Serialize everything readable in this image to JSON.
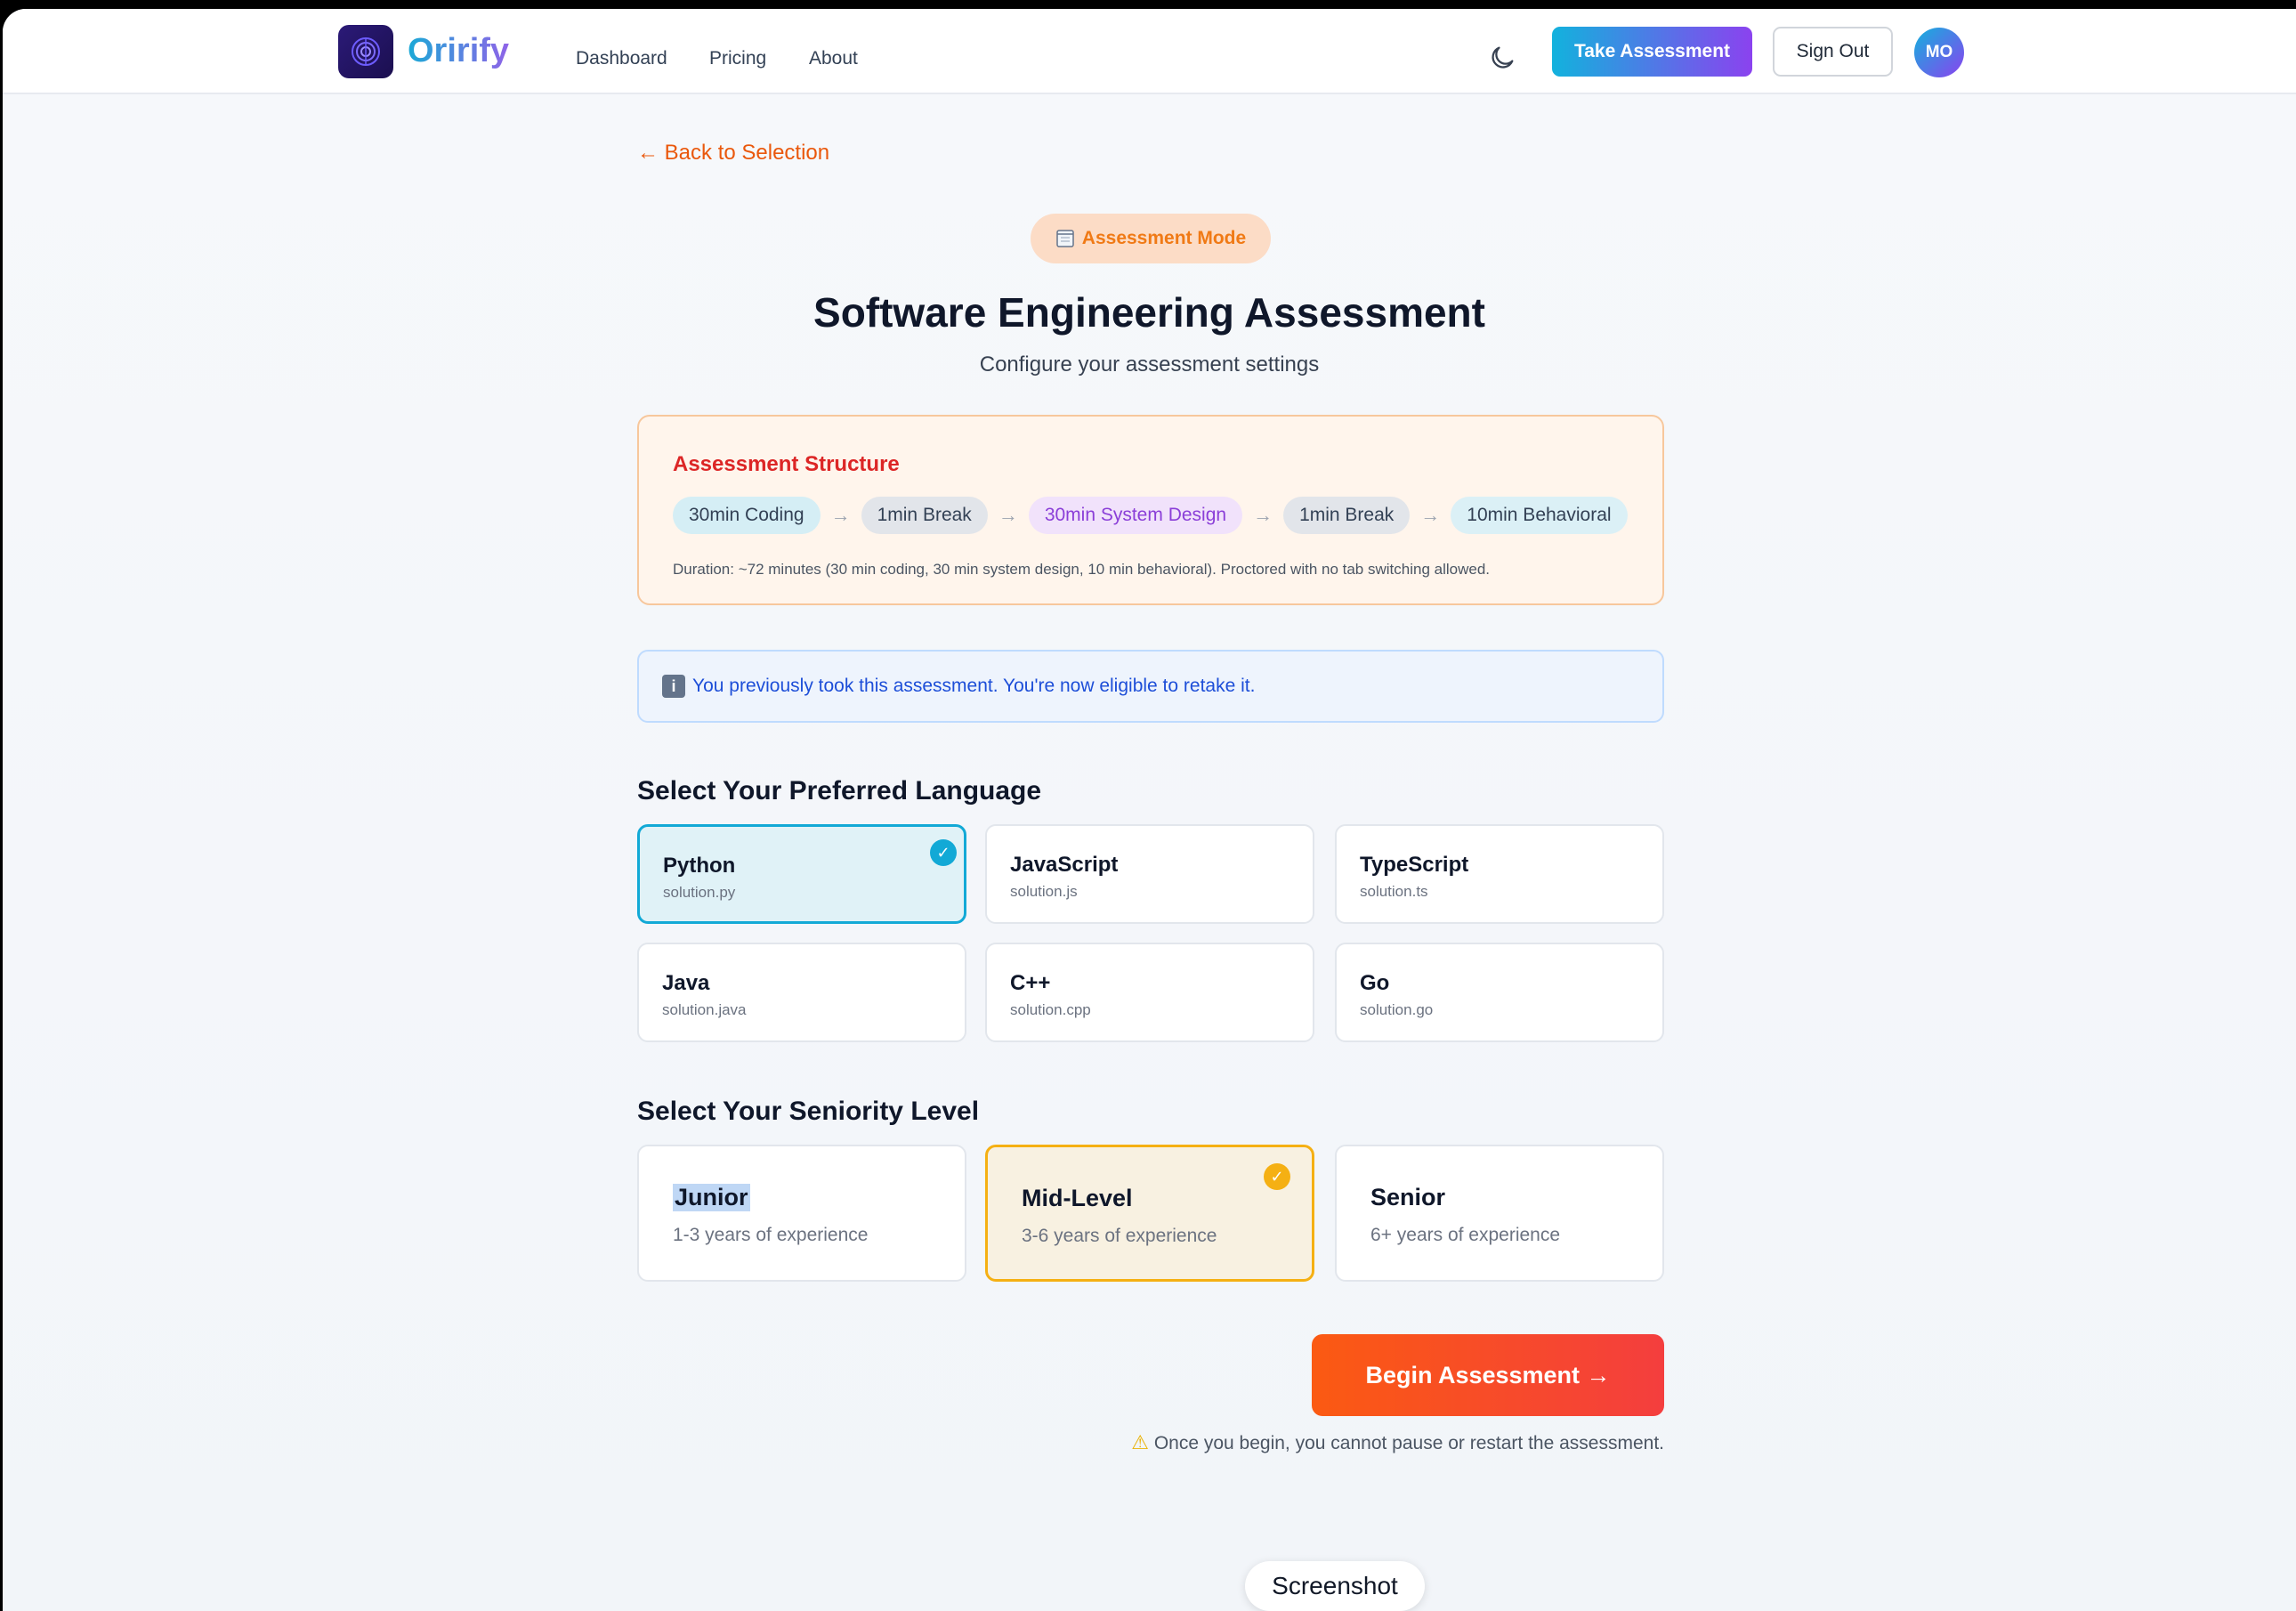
{
  "header": {
    "brand": "Orirify",
    "nav": [
      "Dashboard",
      "Pricing",
      "About"
    ],
    "take_assessment": "Take Assessment",
    "sign_out": "Sign Out",
    "avatar_initials": "MO"
  },
  "back_link": "← Back to Selection",
  "mode_badge": "Assessment Mode",
  "title": "Software Engineering Assessment",
  "subtitle": "Configure your assessment settings",
  "structure": {
    "heading": "Assessment Structure",
    "steps": [
      "30min Coding",
      "1min Break",
      "30min System Design",
      "1min Break",
      "10min Behavioral"
    ],
    "arrow": "→",
    "duration": "Duration: ~72 minutes (30 min coding, 30 min system design, 10 min behavioral). Proctored with no tab switching allowed."
  },
  "info": {
    "icon": "i",
    "text": "You previously took this assessment. You're now eligible to retake it."
  },
  "language": {
    "heading": "Select Your Preferred Language",
    "options": [
      {
        "name": "Python",
        "file": "solution.py",
        "selected": true
      },
      {
        "name": "JavaScript",
        "file": "solution.js",
        "selected": false
      },
      {
        "name": "TypeScript",
        "file": "solution.ts",
        "selected": false
      },
      {
        "name": "Java",
        "file": "solution.java",
        "selected": false
      },
      {
        "name": "C++",
        "file": "solution.cpp",
        "selected": false
      },
      {
        "name": "Go",
        "file": "solution.go",
        "selected": false
      }
    ]
  },
  "seniority": {
    "heading": "Select Your Seniority Level",
    "options": [
      {
        "name": "Junior",
        "desc": "1-3 years of experience",
        "selected": false
      },
      {
        "name": "Mid-Level",
        "desc": "3-6 years of experience",
        "selected": true
      },
      {
        "name": "Senior",
        "desc": "6+ years of experience",
        "selected": false
      }
    ]
  },
  "begin_button": "Begin Assessment →",
  "warning": "Once you begin, you cannot pause or restart the assessment.",
  "tooltip": "Screenshot",
  "colors": {
    "accent_orange": "#ea580c",
    "selected_blue": "#12a9d6",
    "selected_amber": "#f5b013"
  }
}
